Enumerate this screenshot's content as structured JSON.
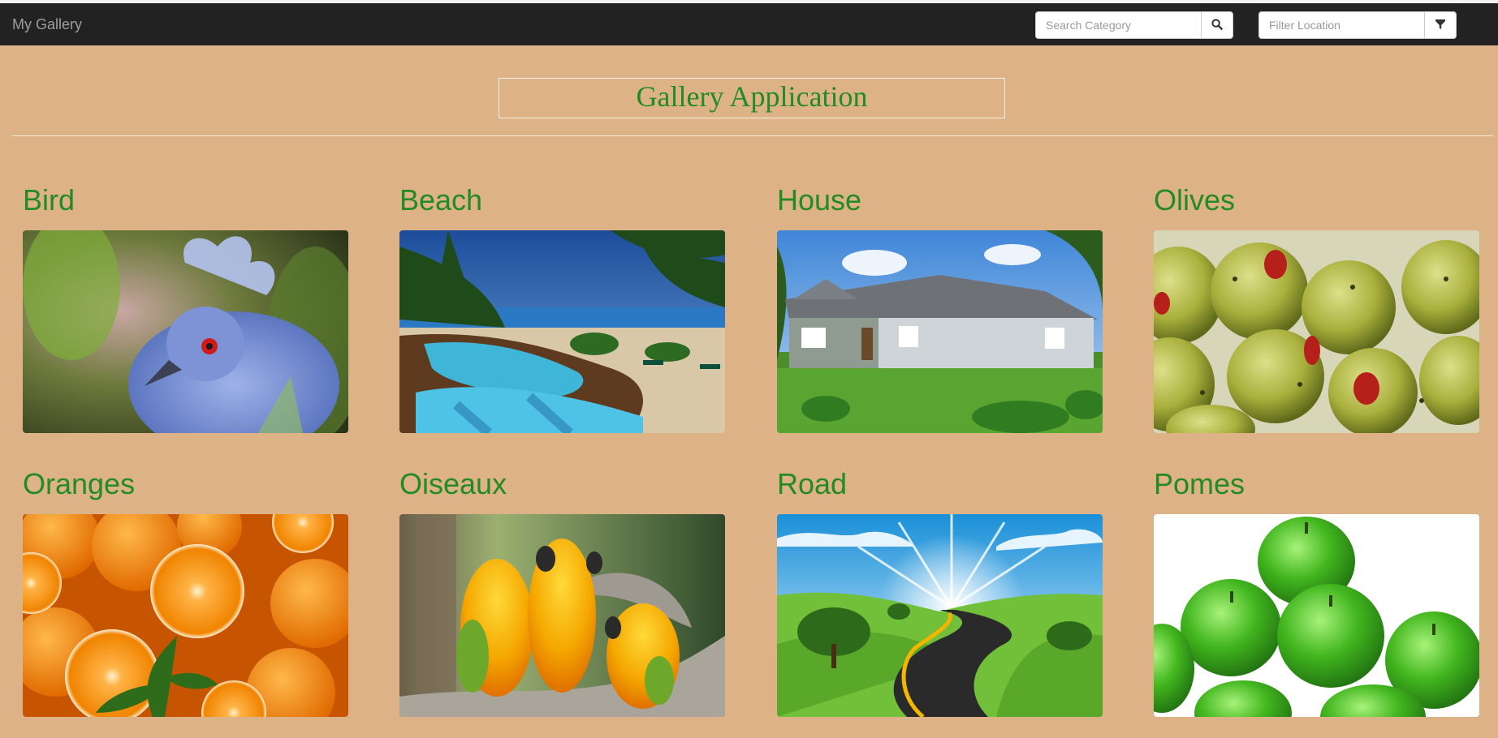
{
  "navbar": {
    "brand": "My Gallery",
    "search_placeholder": "Search Category",
    "filter_placeholder": "Filter Location"
  },
  "page": {
    "heading": "Gallery Application"
  },
  "gallery": [
    {
      "title": "Bird"
    },
    {
      "title": "Beach"
    },
    {
      "title": "House"
    },
    {
      "title": "Olives"
    },
    {
      "title": "Oranges"
    },
    {
      "title": "Oiseaux"
    },
    {
      "title": "Road"
    },
    {
      "title": "Pomes"
    }
  ]
}
